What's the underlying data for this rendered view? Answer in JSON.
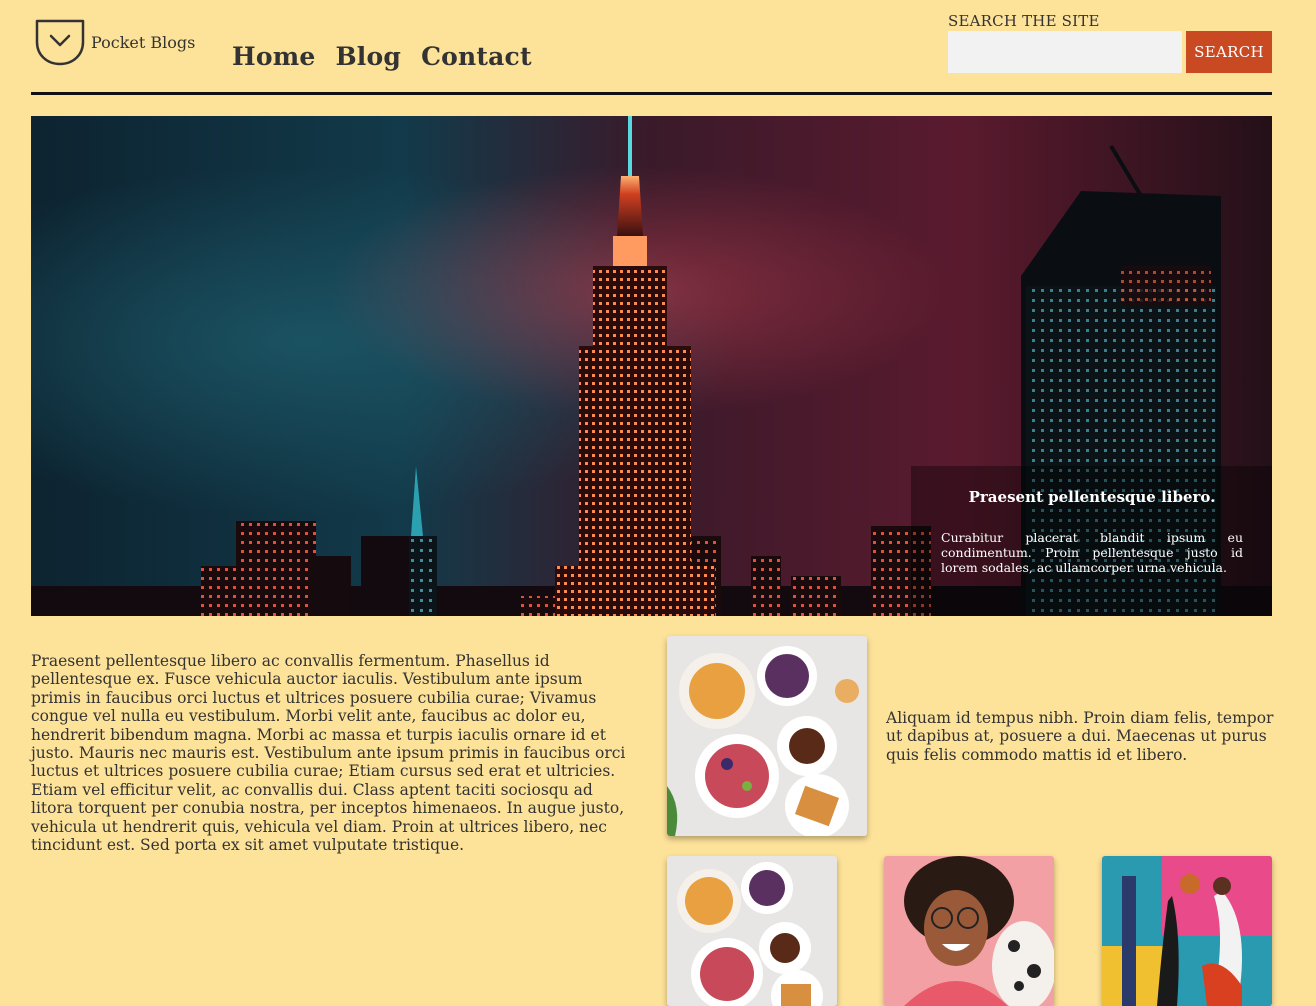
{
  "header": {
    "brand": "Pocket Blogs",
    "logo_icon": "pocket-icon",
    "nav": [
      {
        "label": "Home"
      },
      {
        "label": "Blog"
      },
      {
        "label": "Contact"
      }
    ],
    "search": {
      "label": "SEARCH THE SITE",
      "value": "",
      "placeholder": "",
      "button_label": "SEARCH"
    }
  },
  "hero": {
    "title": "Praesent pellentesque libero.",
    "text": "Curabitur placerat blandit ipsum eu condimentum. Proin pellentesque justo id lorem sodales, ac ullamcorper urna vehicula."
  },
  "main": {
    "body": "Praesent pellentesque libero ac convallis fermentum. Phasellus id pellentesque ex. Fusce vehicula auctor iaculis. Vestibulum ante ipsum primis in faucibus orci luctus et ultrices posuere cubilia curae; Vivamus congue vel nulla eu vestibulum. Morbi velit ante, faucibus ac dolor eu, hendrerit bibendum magna. Morbi ac massa et turpis iaculis ornare id et justo. Mauris nec mauris est. Vestibulum ante ipsum primis in faucibus orci luctus et ultrices posuere cubilia curae; Etiam cursus sed erat et ultricies. Etiam vel efficitur velit, ac convallis dui. Class aptent taciti sociosqu ad litora torquent per conubia nostra, per inceptos himenaeos. In augue justo, vehicula ut hendrerit quis, vehicula vel diam. Proin at ultrices libero, nec tincidunt est. Sed porta ex sit amet vulputate tristique.",
    "side_text": "Aliquam id tempus nibh. Proin diam felis, tempor ut dapibus at, posuere a dui. Maecenas ut purus quis felis commodo mattis id et libero."
  },
  "colors": {
    "background": "#fde299",
    "accent": "#c94a22",
    "text": "#333333"
  }
}
